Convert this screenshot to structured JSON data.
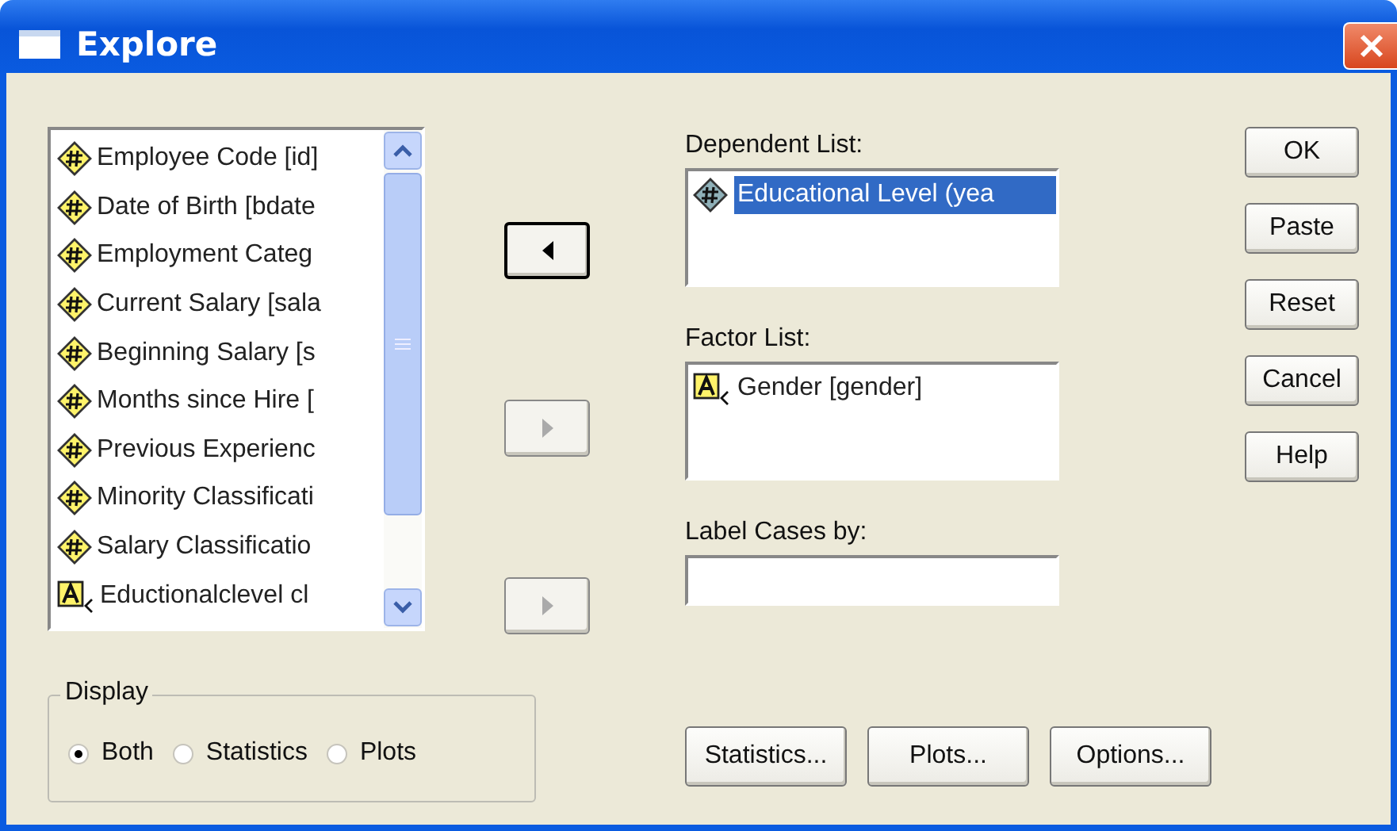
{
  "window": {
    "title": "Explore"
  },
  "variables": [
    {
      "label": "Employee Code [id]",
      "kind": "scale"
    },
    {
      "label": "Date of Birth [bdate",
      "kind": "scale"
    },
    {
      "label": "Employment Categ",
      "kind": "scale"
    },
    {
      "label": "Current Salary [sala",
      "kind": "scale"
    },
    {
      "label": "Beginning Salary [s",
      "kind": "scale"
    },
    {
      "label": "Months since Hire [",
      "kind": "scale"
    },
    {
      "label": "Previous Experienc",
      "kind": "scale"
    },
    {
      "label": "Minority Classificati",
      "kind": "scale"
    },
    {
      "label": "Salary Classificatio",
      "kind": "scale"
    },
    {
      "label": "Eductionalclevel cl",
      "kind": "nominal"
    }
  ],
  "arrow_buttons": [
    {
      "kind": "left",
      "disabled": false,
      "focused": true
    },
    {
      "kind": "right",
      "disabled": true,
      "focused": false
    },
    {
      "kind": "right",
      "disabled": true,
      "focused": false
    }
  ],
  "dependent_list": {
    "label": "Dependent List:",
    "items": [
      {
        "label": "Educational Level (yea",
        "kind": "scale",
        "selected": true
      }
    ]
  },
  "factor_list": {
    "label": "Factor List:",
    "items": [
      {
        "label": "Gender [gender]",
        "kind": "nominal",
        "selected": false
      }
    ]
  },
  "label_cases": {
    "label": "Label Cases by:"
  },
  "buttons": [
    "OK",
    "Paste",
    "Reset",
    "Cancel",
    "Help"
  ],
  "display": {
    "title": "Display",
    "options": [
      {
        "label": "Both",
        "selected": true
      },
      {
        "label": "Statistics",
        "selected": false
      },
      {
        "label": "Plots",
        "selected": false
      }
    ]
  },
  "bottom_buttons": [
    "Statistics...",
    "Plots...",
    "Options..."
  ]
}
